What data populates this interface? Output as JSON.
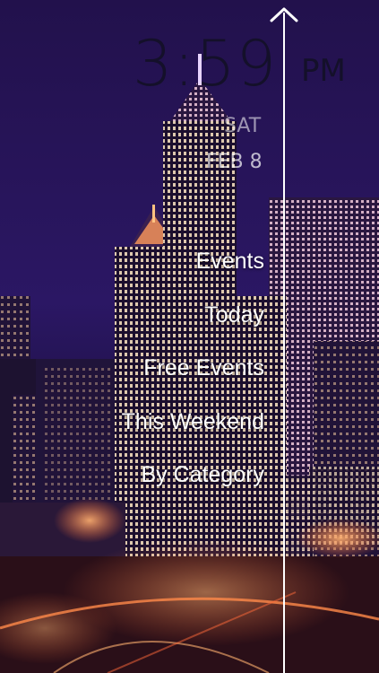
{
  "lockscreen": {
    "time": "3:59",
    "ampm": "PM",
    "weekday": "SAT",
    "date": "FEB 8"
  },
  "menu": {
    "items": [
      {
        "label": "Events"
      },
      {
        "label": "Today"
      },
      {
        "label": "Free Events"
      },
      {
        "label": "This Weekend"
      },
      {
        "label": "By Category"
      }
    ]
  },
  "icons": {
    "collapse": "chevron-up-icon"
  },
  "colors": {
    "sky": "#23124f",
    "text": "#ffffff",
    "clock": "#14102a"
  }
}
